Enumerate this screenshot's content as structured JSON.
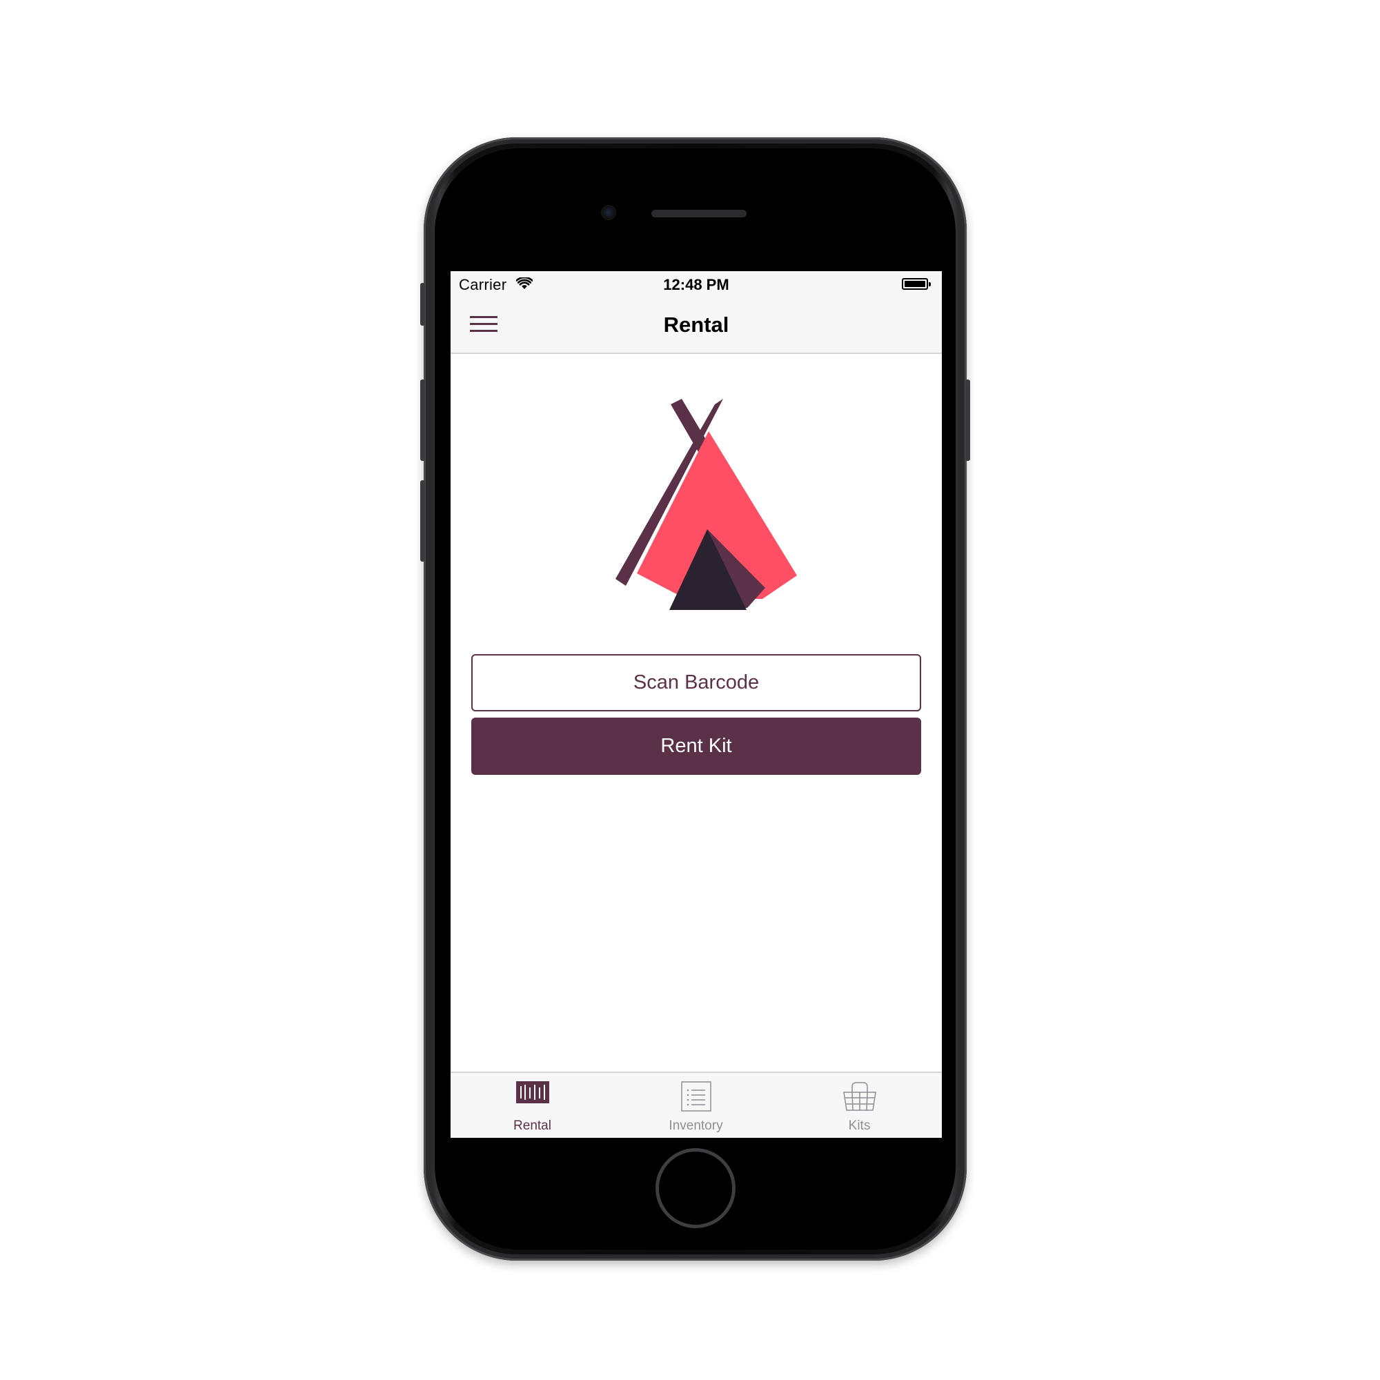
{
  "status_bar": {
    "carrier": "Carrier",
    "time": "12:48 PM"
  },
  "nav": {
    "title": "Rental",
    "menu_icon": "hamburger-menu-icon"
  },
  "logo": {
    "icon": "teepee-tent-logo",
    "colors": {
      "pole": "#5b3148",
      "tent": "#ff4f65",
      "door_dark": "#2b2230",
      "door_flap": "#5b3148"
    }
  },
  "actions": {
    "scan_label": "Scan Barcode",
    "rent_label": "Rent Kit"
  },
  "tabs": [
    {
      "label": "Rental",
      "icon": "barcode-icon",
      "active": true
    },
    {
      "label": "Inventory",
      "icon": "list-icon",
      "active": false
    },
    {
      "label": "Kits",
      "icon": "basket-icon",
      "active": false
    }
  ],
  "colors": {
    "accent": "#5b3148",
    "inactive": "#8e8e93",
    "bar_background": "#f7f7f7"
  }
}
